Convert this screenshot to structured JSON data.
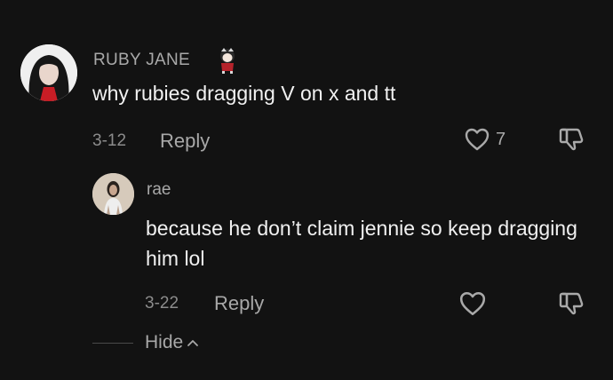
{
  "comment": {
    "username": "RUBY JANE",
    "text": "why rubies dragging V on x and tt",
    "date": "3-12",
    "reply_label": "Reply",
    "like_count": "7",
    "icons": {
      "like": "heart-icon",
      "dislike": "thumbs-down-icon",
      "badge": "character-badge"
    }
  },
  "reply": {
    "username": "rae",
    "text": "because he don’t claim jennie so keep dragging him lol",
    "date": "3-22",
    "reply_label": "Reply",
    "icons": {
      "like": "heart-icon",
      "dislike": "thumbs-down-icon"
    }
  },
  "thread": {
    "hide_label": "Hide",
    "hide_icon": "chevron-up-icon"
  },
  "colors": {
    "background": "#121212",
    "text_primary": "#f1f1f1",
    "text_secondary": "#a9a9a9"
  }
}
